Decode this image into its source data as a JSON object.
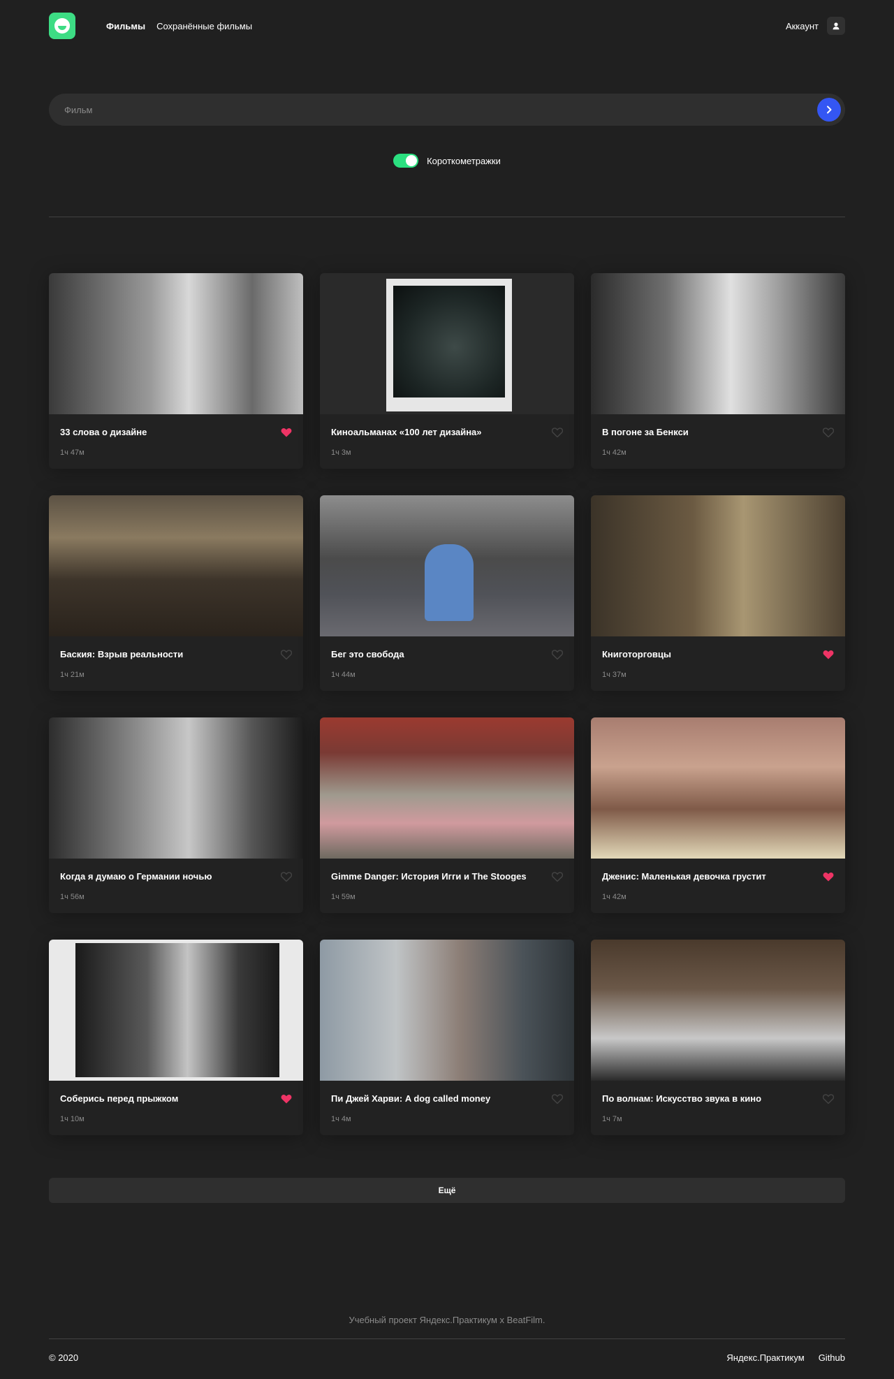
{
  "header": {
    "nav": [
      {
        "label": "Фильмы",
        "active": true
      },
      {
        "label": "Сохранённые фильмы",
        "active": false
      }
    ],
    "account_label": "Аккаунт"
  },
  "search": {
    "placeholder": "Фильм",
    "value": ""
  },
  "filter": {
    "label": "Короткометражки",
    "enabled": true
  },
  "movies": [
    {
      "title": "33 слова о дизайне",
      "duration": "1ч 47м",
      "saved": true
    },
    {
      "title": "Киноальманах «100 лет дизайна»",
      "duration": "1ч 3м",
      "saved": false
    },
    {
      "title": "В погоне за Бенкси",
      "duration": "1ч 42м",
      "saved": false
    },
    {
      "title": "Баския: Взрыв реальности",
      "duration": "1ч 21м",
      "saved": false
    },
    {
      "title": "Бег это свобода",
      "duration": "1ч 44м",
      "saved": false
    },
    {
      "title": "Книготорговцы",
      "duration": "1ч 37м",
      "saved": true
    },
    {
      "title": "Когда я думаю о Германии ночью",
      "duration": "1ч 56м",
      "saved": false
    },
    {
      "title": "Gimme Danger: История Игги и The Stooges",
      "duration": "1ч 59м",
      "saved": false
    },
    {
      "title": "Дженис: Маленькая девочка грустит",
      "duration": "1ч 42м",
      "saved": true
    },
    {
      "title": "Соберись перед прыжком",
      "duration": "1ч 10м",
      "saved": true
    },
    {
      "title": "Пи Джей Харви: A dog called money",
      "duration": "1ч 4м",
      "saved": false
    },
    {
      "title": "По волнам: Искусство звука в кино",
      "duration": "1ч 7м",
      "saved": false
    }
  ],
  "more_label": "Ещё",
  "footer": {
    "note": "Учебный проект Яндекс.Практикум х BeatFilm.",
    "copyright": "© 2020",
    "links": [
      "Яндекс.Практикум",
      "Github"
    ]
  },
  "colors": {
    "background": "#202020",
    "accent_green": "#3ddc84",
    "search_button": "#3456f3",
    "heart_active": "#ee3465",
    "heart_inactive": "#424242"
  }
}
